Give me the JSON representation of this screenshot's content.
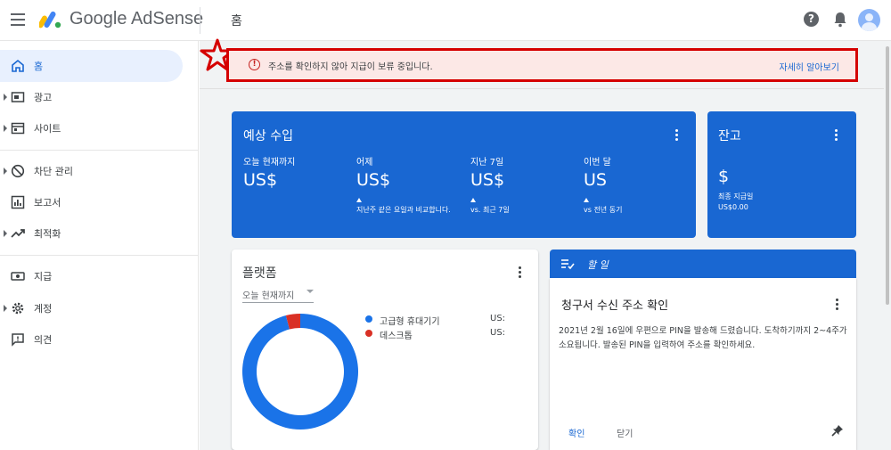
{
  "app": {
    "brand": "Google AdSense",
    "page_title": "홈"
  },
  "sidebar": {
    "items": [
      {
        "label": "홈",
        "icon": "home-icon",
        "active": true
      },
      {
        "label": "광고",
        "icon": "ads-icon",
        "active": false
      },
      {
        "label": "사이트",
        "icon": "sites-icon",
        "active": false
      },
      {
        "label": "차단 관리",
        "icon": "block-icon",
        "active": false
      },
      {
        "label": "보고서",
        "icon": "reports-icon",
        "active": false
      },
      {
        "label": "최적화",
        "icon": "trending-icon",
        "active": false
      },
      {
        "label": "지급",
        "icon": "payments-icon",
        "active": false
      },
      {
        "label": "계정",
        "icon": "gear-icon",
        "active": false
      },
      {
        "label": "의견",
        "icon": "feedback-icon",
        "active": false
      }
    ]
  },
  "alert": {
    "message": "주소를 확인하지 않아 지급이 보류 중입니다.",
    "link": "자세히 알아보기",
    "icon": "error-icon"
  },
  "earnings": {
    "title": "예상 수입",
    "columns": [
      {
        "label": "오늘 현재까지",
        "value": "US$",
        "note": ""
      },
      {
        "label": "어제",
        "value": "US$",
        "note": "지난주 같은 요일과 비교합니다."
      },
      {
        "label": "지난 7일",
        "value": "US$",
        "note": "vs. 최근 7일"
      },
      {
        "label": "이번 달",
        "value": "US",
        "note": "vs 전년 동기"
      }
    ]
  },
  "balance": {
    "title": "잔고",
    "value": "$",
    "last_payment_label": "최종 지급일",
    "last_payment_value": "US$0.00"
  },
  "platform": {
    "title": "플랫폼",
    "range": "오늘 현재까지",
    "legend": [
      {
        "label": "고급형 휴대기기",
        "value": "US:",
        "color": "#1a73e8"
      },
      {
        "label": "데스크톱",
        "value": "US:",
        "color": "#d93025"
      }
    ],
    "chart_data": {
      "type": "pie",
      "categories": [
        "고급형 휴대기기",
        "데스크톱"
      ],
      "values": [
        96,
        4
      ],
      "colors": [
        "#1a73e8",
        "#d93025"
      ]
    }
  },
  "todo": {
    "header": "할 일",
    "title": "청구서 수신 주소 확인",
    "body": "2021년 2월 16일에 우편으로 PIN을 발송해 드렸습니다. 도착하기까지 2~4주가 소요됩니다. 발송된 PIN을 입력하여 주소를 확인하세요.",
    "confirm": "확인",
    "close": "닫기"
  },
  "colors": {
    "accent": "#1967d2",
    "alert_bg": "#fce8e6",
    "alert_border": "#d50000"
  }
}
